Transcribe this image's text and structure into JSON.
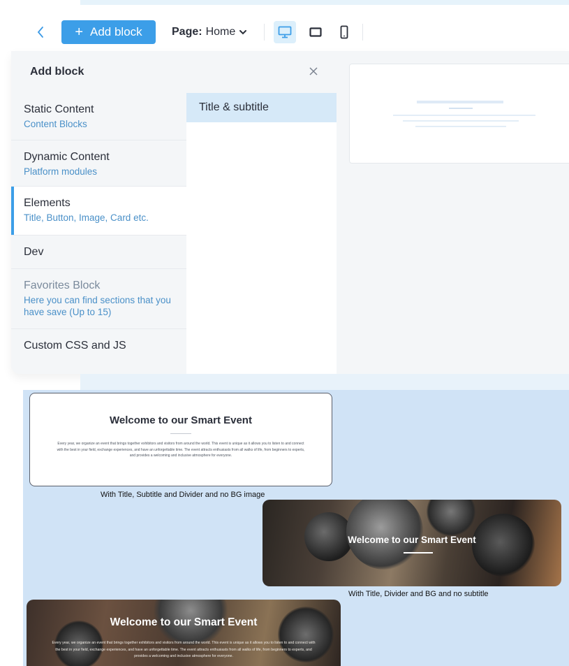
{
  "toolbar": {
    "back_icon": "chevron-left-icon",
    "add_block_label": "+ Add block",
    "add_block_plus": "+",
    "add_block_text": "Add block",
    "page_label": "Page:",
    "page_value": "Home",
    "devices": [
      "desktop-icon",
      "tablet-icon",
      "mobile-icon"
    ],
    "active_device": "desktop"
  },
  "panel": {
    "title": "Add block",
    "categories": [
      {
        "title": "Static Content",
        "subtitle": "Content Blocks"
      },
      {
        "title": "Dynamic Content",
        "subtitle": "Platform modules"
      },
      {
        "title": "Elements",
        "subtitle": "Title, Button, Image, Card etc.",
        "active": true
      },
      {
        "title": "Dev",
        "subtitle": ""
      },
      {
        "title": "Favorites Block",
        "subtitle": "Here you can find sections that you have save (Up to 15)"
      },
      {
        "title": "Custom CSS and JS",
        "subtitle": ""
      }
    ],
    "items": [
      {
        "label": "Title & subtitle",
        "selected": true
      }
    ]
  },
  "examples": {
    "card1": {
      "title": "Welcome to our Smart Event",
      "body": "Every year, we organize an event that brings together exhibitors and visitors from around the world. This event is unique as it allows you to listen to and connect with the best in your field, exchange experiences, and have an unforgettable time. The event attracts enthusiasts from all walks of life, from beginners to experts, and provides a welcoming and inclusive atmosphere for everyone.",
      "caption": "With Title, Subtitle and Divider and no BG image"
    },
    "card2": {
      "title": "Welcome to our Smart Event",
      "caption": "With Title, Divider and  BG and no subtitle"
    },
    "card3": {
      "title": "Welcome to our Smart Event",
      "body": "Every year, we organize an event that brings together exhibitors and visitors from around the world. This event is unique as it allows you to listen to and connect with the best in your field, exchange experiences, and have an unforgettable time. The event attracts enthusiasts from all walks of life, from beginners to experts, and provides a welcoming and inclusive atmosphere for everyone."
    }
  },
  "colors": {
    "accent": "#3c9ee8",
    "selected_bg": "#d6e9f8",
    "panel_bg": "#f4f6f8",
    "showcase_bg": "#d0e3f6"
  }
}
